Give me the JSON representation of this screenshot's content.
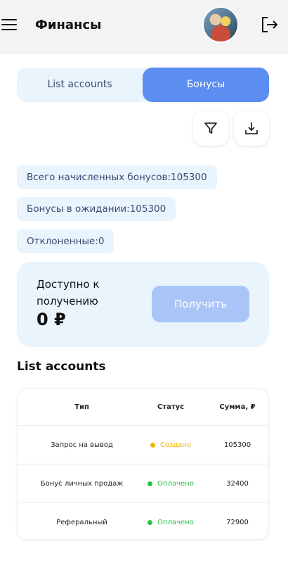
{
  "header": {
    "title": "Финансы"
  },
  "tabs": [
    {
      "label": "List accounts",
      "active": false
    },
    {
      "label": "Бонусы",
      "active": true
    }
  ],
  "actions": {
    "filter_icon": "filter-icon",
    "download_icon": "download-icon"
  },
  "stats": {
    "total": "Всего начисленных бонусов:105300",
    "pending": "Бонусы в ожидании:105300",
    "rejected": "Отклоненные:0"
  },
  "available": {
    "label": "Доступно к получению",
    "amount": "0 ₽",
    "button": "Получить"
  },
  "list": {
    "title": "List accounts",
    "columns": [
      "Тип",
      "Статус",
      "Сумма, ₽"
    ],
    "rows": [
      {
        "type": "Запрос на вывод",
        "status": "Создано",
        "status_color": "#f0b400",
        "sum": "105300"
      },
      {
        "type": "Бонус личных продаж",
        "status": "Оплачено",
        "status_color": "#2ec04a",
        "sum": "32400"
      },
      {
        "type": "Реферальный",
        "status": "Оплачено",
        "status_color": "#2ec04a",
        "sum": "72900"
      }
    ]
  },
  "colors": {
    "accent": "#5b8ef0",
    "panel": "#e9f4fd",
    "button_disabled": "#a9c4f7"
  }
}
